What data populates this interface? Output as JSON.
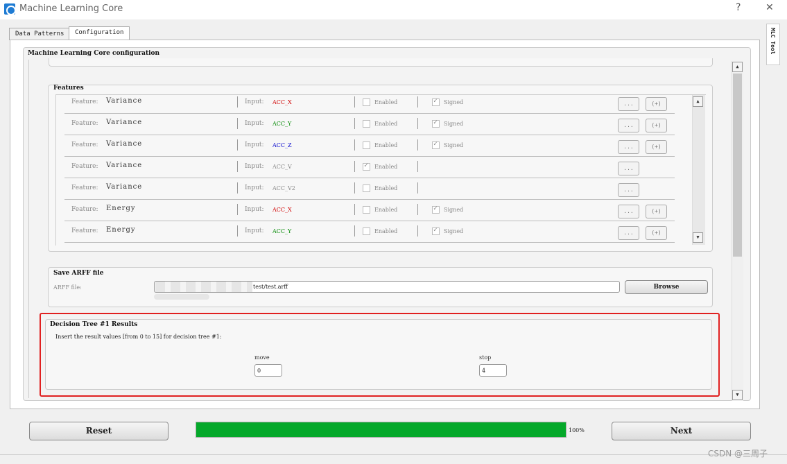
{
  "window": {
    "title": "Machine Learning Core",
    "help": "?",
    "close": "✕"
  },
  "tabs": [
    "Data Patterns",
    "Configuration"
  ],
  "side_tab": "MLC Tool",
  "main_group_title": "Machine Learning Core configuration",
  "features": {
    "title": "Features",
    "feature_prefix": "Feature:",
    "input_prefix": "Input:",
    "enabled_label": "Enabled",
    "signed_label": "Signed",
    "dots_label": "...",
    "plus_label": "(+)",
    "rows": [
      {
        "name": "Variance",
        "input": "ACC_X",
        "input_color": "#d00000",
        "enabled": false,
        "signed": true,
        "has_signed": true
      },
      {
        "name": "Variance",
        "input": "ACC_Y",
        "input_color": "#008800",
        "enabled": false,
        "signed": true,
        "has_signed": true
      },
      {
        "name": "Variance",
        "input": "ACC_Z",
        "input_color": "#0000cc",
        "enabled": false,
        "signed": true,
        "has_signed": true
      },
      {
        "name": "Variance",
        "input": "ACC_V",
        "input_color": "#888888",
        "enabled": true,
        "signed": false,
        "has_signed": false
      },
      {
        "name": "Variance",
        "input": "ACC_V2",
        "input_color": "#888888",
        "enabled": false,
        "signed": false,
        "has_signed": false
      },
      {
        "name": "Energy",
        "input": "ACC_X",
        "input_color": "#d00000",
        "enabled": false,
        "signed": true,
        "has_signed": true
      },
      {
        "name": "Energy",
        "input": "ACC_Y",
        "input_color": "#008800",
        "enabled": false,
        "signed": true,
        "has_signed": true
      }
    ]
  },
  "arff": {
    "title": "Save ARFF file",
    "label": "ARFF file:",
    "path": "test/test.arff",
    "browse": "Browse"
  },
  "decision_tree": {
    "title": "Decision Tree #1 Results",
    "instruction": "Insert the result values [from 0 to 15] for decision tree #1:",
    "move_label": "move",
    "move_value": "0",
    "stop_label": "stop",
    "stop_value": "4"
  },
  "footer": {
    "reset": "Reset",
    "next": "Next",
    "progress": 1.0,
    "progress_text": "100%",
    "progress_color": "#05a82a"
  },
  "watermark": "CSDN @三周子",
  "highlight_color": "#e02020"
}
